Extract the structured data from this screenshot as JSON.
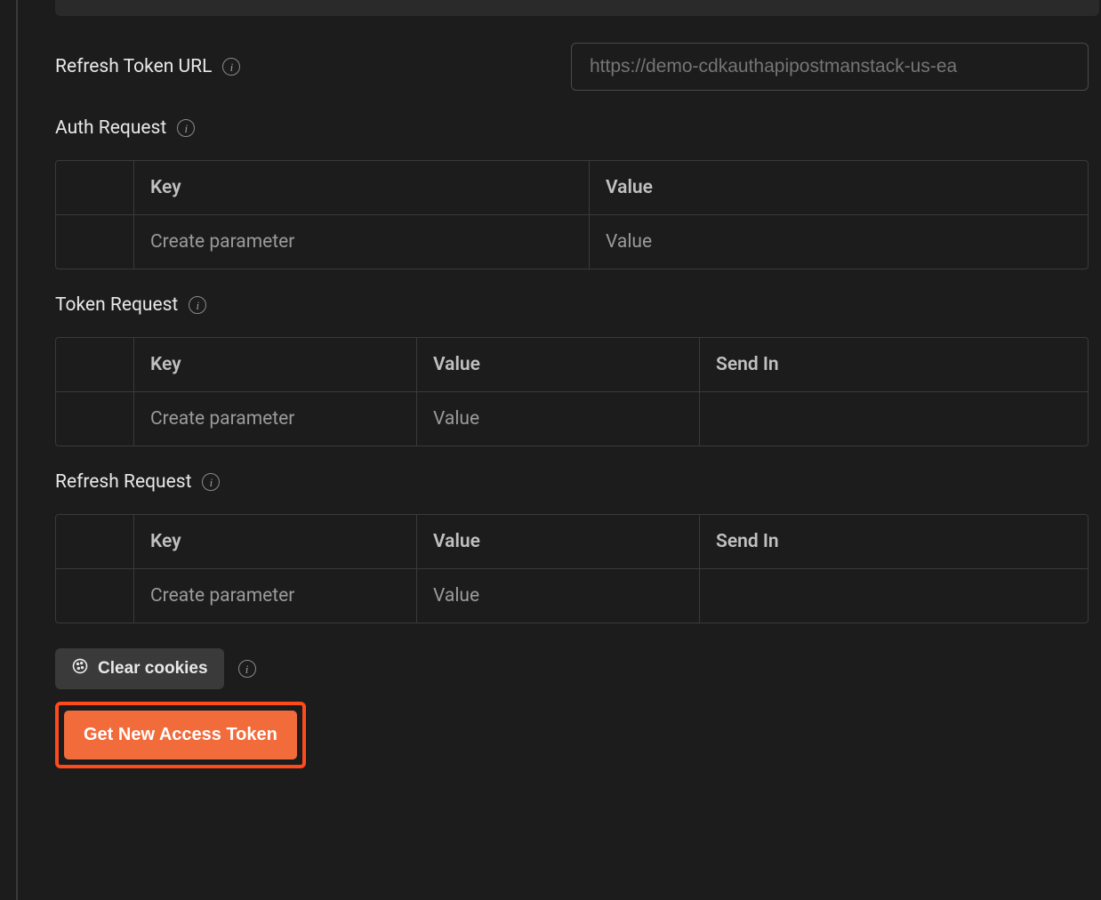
{
  "fields": {
    "refresh_token_url": {
      "label": "Refresh Token URL",
      "placeholder": "https://demo-cdkauthapipostmanstack-us-ea"
    }
  },
  "sections": {
    "auth_request": {
      "label": "Auth Request",
      "columns": {
        "key": "Key",
        "value": "Value"
      },
      "placeholders": {
        "key": "Create parameter",
        "value": "Value"
      }
    },
    "token_request": {
      "label": "Token Request",
      "columns": {
        "key": "Key",
        "value": "Value",
        "sendin": "Send In"
      },
      "placeholders": {
        "key": "Create parameter",
        "value": "Value"
      }
    },
    "refresh_request": {
      "label": "Refresh Request",
      "columns": {
        "key": "Key",
        "value": "Value",
        "sendin": "Send In"
      },
      "placeholders": {
        "key": "Create parameter",
        "value": "Value"
      }
    }
  },
  "buttons": {
    "clear_cookies": "Clear cookies",
    "get_new_access_token": "Get New Access Token"
  }
}
